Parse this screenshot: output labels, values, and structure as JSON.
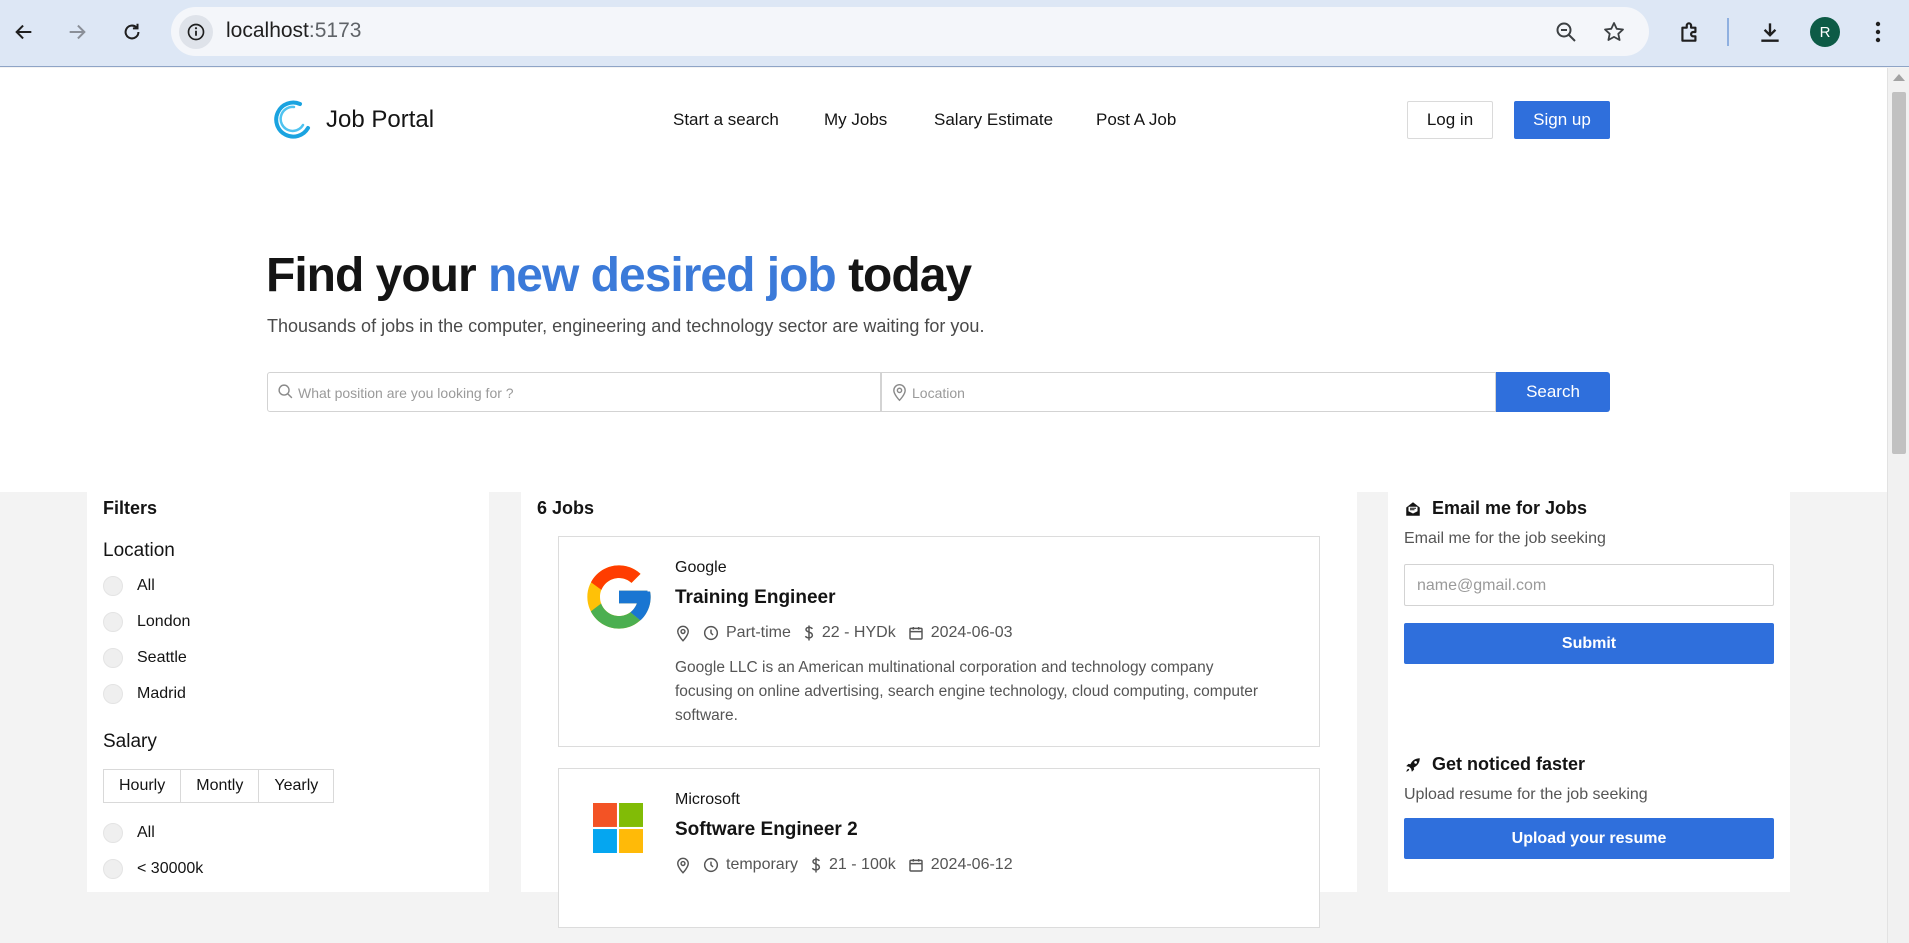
{
  "browser": {
    "url_host": "localhost",
    "url_port": ":5173",
    "profile_initial": "R"
  },
  "header": {
    "brand": "Job Portal",
    "nav": [
      "Start a search",
      "My Jobs",
      "Salary Estimate",
      "Post A Job"
    ],
    "login_label": "Log in",
    "signup_label": "Sign up"
  },
  "hero": {
    "title_pre": "Find your ",
    "title_accent": "new desired job",
    "title_post": " today",
    "subtitle": "Thousands of jobs in the computer, engineering and technology sector are waiting for you.",
    "position_placeholder": "What position are you looking for ?",
    "location_placeholder": "Location",
    "search_label": "Search"
  },
  "filters": {
    "title": "Filters",
    "location_title": "Location",
    "locations": [
      "All",
      "London",
      "Seattle",
      "Madrid"
    ],
    "salary_title": "Salary",
    "salary_periods": [
      "Hourly",
      "Montly",
      "Yearly"
    ],
    "salary_ranges": [
      "All",
      "< 30000k"
    ]
  },
  "jobs": {
    "count_label": "6 Jobs",
    "items": [
      {
        "company": "Google",
        "title": "Training Engineer",
        "type": "Part-time",
        "salary": "22 - HYDk",
        "date": "2024-06-03",
        "description": "Google LLC is an American multinational corporation and technology company focusing on online advertising, search engine technology, cloud computing, computer software.",
        "logo": "google-logo"
      },
      {
        "company": "Microsoft",
        "title": "Software Engineer 2",
        "type": "temporary",
        "salary": "21 - 100k",
        "date": "2024-06-12",
        "logo": "microsoft-logo"
      }
    ]
  },
  "sidebar": {
    "email_title": "Email me for Jobs",
    "email_sub": "Email me for the job seeking",
    "email_placeholder": "name@gmail.com",
    "submit_label": "Submit",
    "noticed_title": "Get noticed faster",
    "noticed_sub": "Upload resume for the job seeking",
    "upload_label": "Upload your resume"
  },
  "colors": {
    "accent": "#2f6fdc",
    "title_accent": "#3b7ad9",
    "page_bg": "#f3f3f3"
  }
}
